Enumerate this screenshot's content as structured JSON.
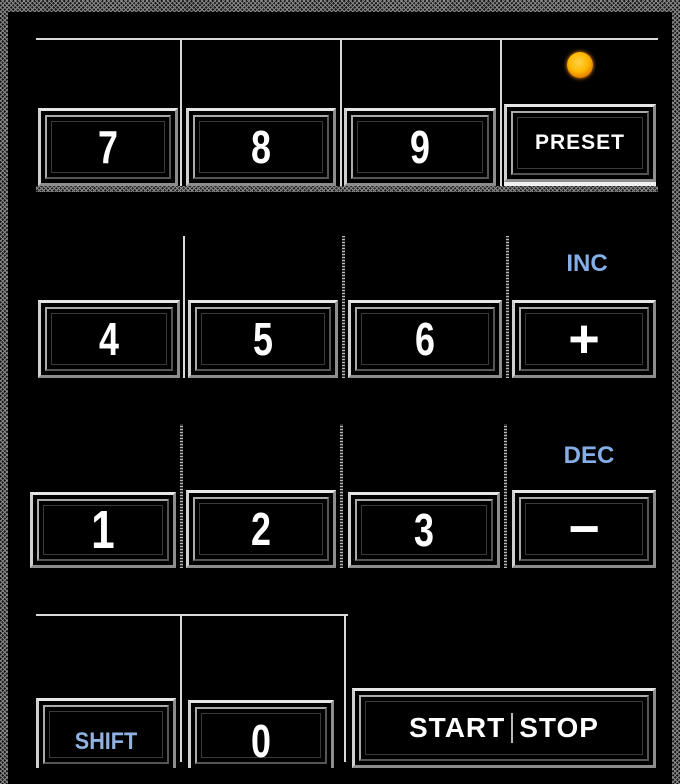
{
  "keypad": {
    "row1": {
      "k7": "7",
      "k8": "8",
      "k9": "9",
      "preset": "PRESET"
    },
    "row2": {
      "k4": "4",
      "k5": "5",
      "k6": "6",
      "inc_label": "INC",
      "plus": "+"
    },
    "row3": {
      "k1": "1",
      "k2": "2",
      "k3": "3",
      "dec_label": "DEC",
      "minus": "−"
    },
    "row4": {
      "shift": "SHIFT",
      "k0": "0",
      "start": "START",
      "stop": "STOP"
    }
  },
  "indicator": {
    "led_color": "#ffb800",
    "led_state": "on"
  },
  "colors": {
    "background": "#000000",
    "key_text": "#ffffff",
    "accent_label": "#86aee6"
  }
}
